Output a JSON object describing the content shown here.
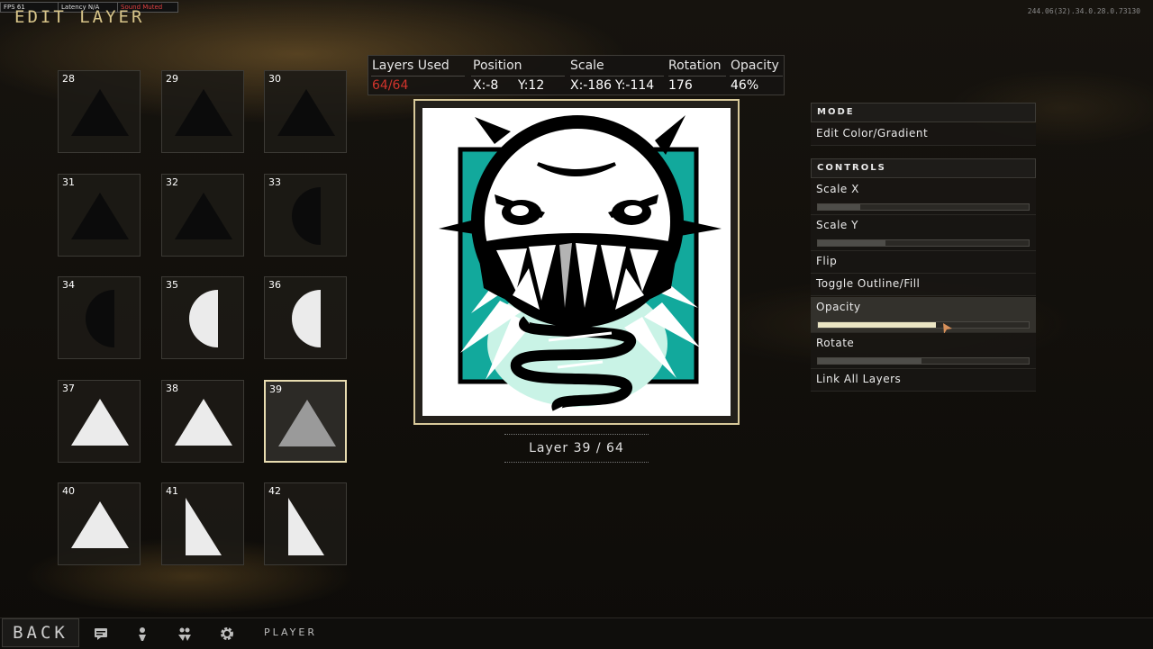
{
  "debug": {
    "fps": "FPS 61",
    "latency": "Latency N/A",
    "sound": "Sound Muted"
  },
  "coords": "244.06(32).34.0.28.0.73130",
  "title": "EDIT LAYER",
  "stats": {
    "layers_used_label": "Layers Used",
    "layers_used_value": "64/64",
    "position_label": "Position",
    "pos_x": "X:-8",
    "pos_y": "Y:12",
    "scale_label": "Scale",
    "scale_x": "X:-186",
    "scale_y": "Y:-114",
    "rotation_label": "Rotation",
    "rotation_value": "176",
    "opacity_label": "Opacity",
    "opacity_value": "46%"
  },
  "layers": [
    {
      "num": "28",
      "shape": "triangle",
      "color": "#0b0b0b"
    },
    {
      "num": "29",
      "shape": "triangle",
      "color": "#0b0b0b"
    },
    {
      "num": "30",
      "shape": "triangle",
      "color": "#0b0b0b"
    },
    {
      "num": "31",
      "shape": "triangle",
      "color": "#0b0b0b"
    },
    {
      "num": "32",
      "shape": "triangle",
      "color": "#0b0b0b"
    },
    {
      "num": "33",
      "shape": "half-circle-right",
      "color": "#0b0b0b"
    },
    {
      "num": "34",
      "shape": "half-circle-right",
      "color": "#0b0b0b"
    },
    {
      "num": "35",
      "shape": "half-circle-left",
      "color": "#ebebeb"
    },
    {
      "num": "36",
      "shape": "half-circle-left",
      "color": "#ebebeb"
    },
    {
      "num": "37",
      "shape": "triangle",
      "color": "#ebebeb"
    },
    {
      "num": "38",
      "shape": "triangle",
      "color": "#ebebeb"
    },
    {
      "num": "39",
      "shape": "triangle",
      "color": "#9a9a9a",
      "selected": true
    },
    {
      "num": "40",
      "shape": "triangle",
      "color": "#ebebeb"
    },
    {
      "num": "41",
      "shape": "right-triangle",
      "color": "#ebebeb"
    },
    {
      "num": "42",
      "shape": "right-triangle",
      "color": "#ebebeb"
    }
  ],
  "layer_indicator": "Layer 39 / 64",
  "mode": {
    "header": "MODE",
    "item": "Edit Color/Gradient"
  },
  "controls": {
    "header": "CONTROLS",
    "scale_x": {
      "label": "Scale X",
      "level": 0.2
    },
    "scale_y": {
      "label": "Scale Y",
      "level": 0.32
    },
    "flip": "Flip",
    "toggle": "Toggle Outline/Fill",
    "opacity": {
      "label": "Opacity",
      "level": 0.56
    },
    "rotate": {
      "label": "Rotate",
      "level": 0.49
    },
    "link": "Link All Layers"
  },
  "bottom": {
    "back": "BACK",
    "player": "PLAYER",
    "icons": [
      "chat-icon",
      "person-icon",
      "party-icon",
      "settings-icon"
    ]
  },
  "colors": {
    "accent": "#d7c489",
    "teal": "#12a99c",
    "alert_red": "#d0342c"
  }
}
